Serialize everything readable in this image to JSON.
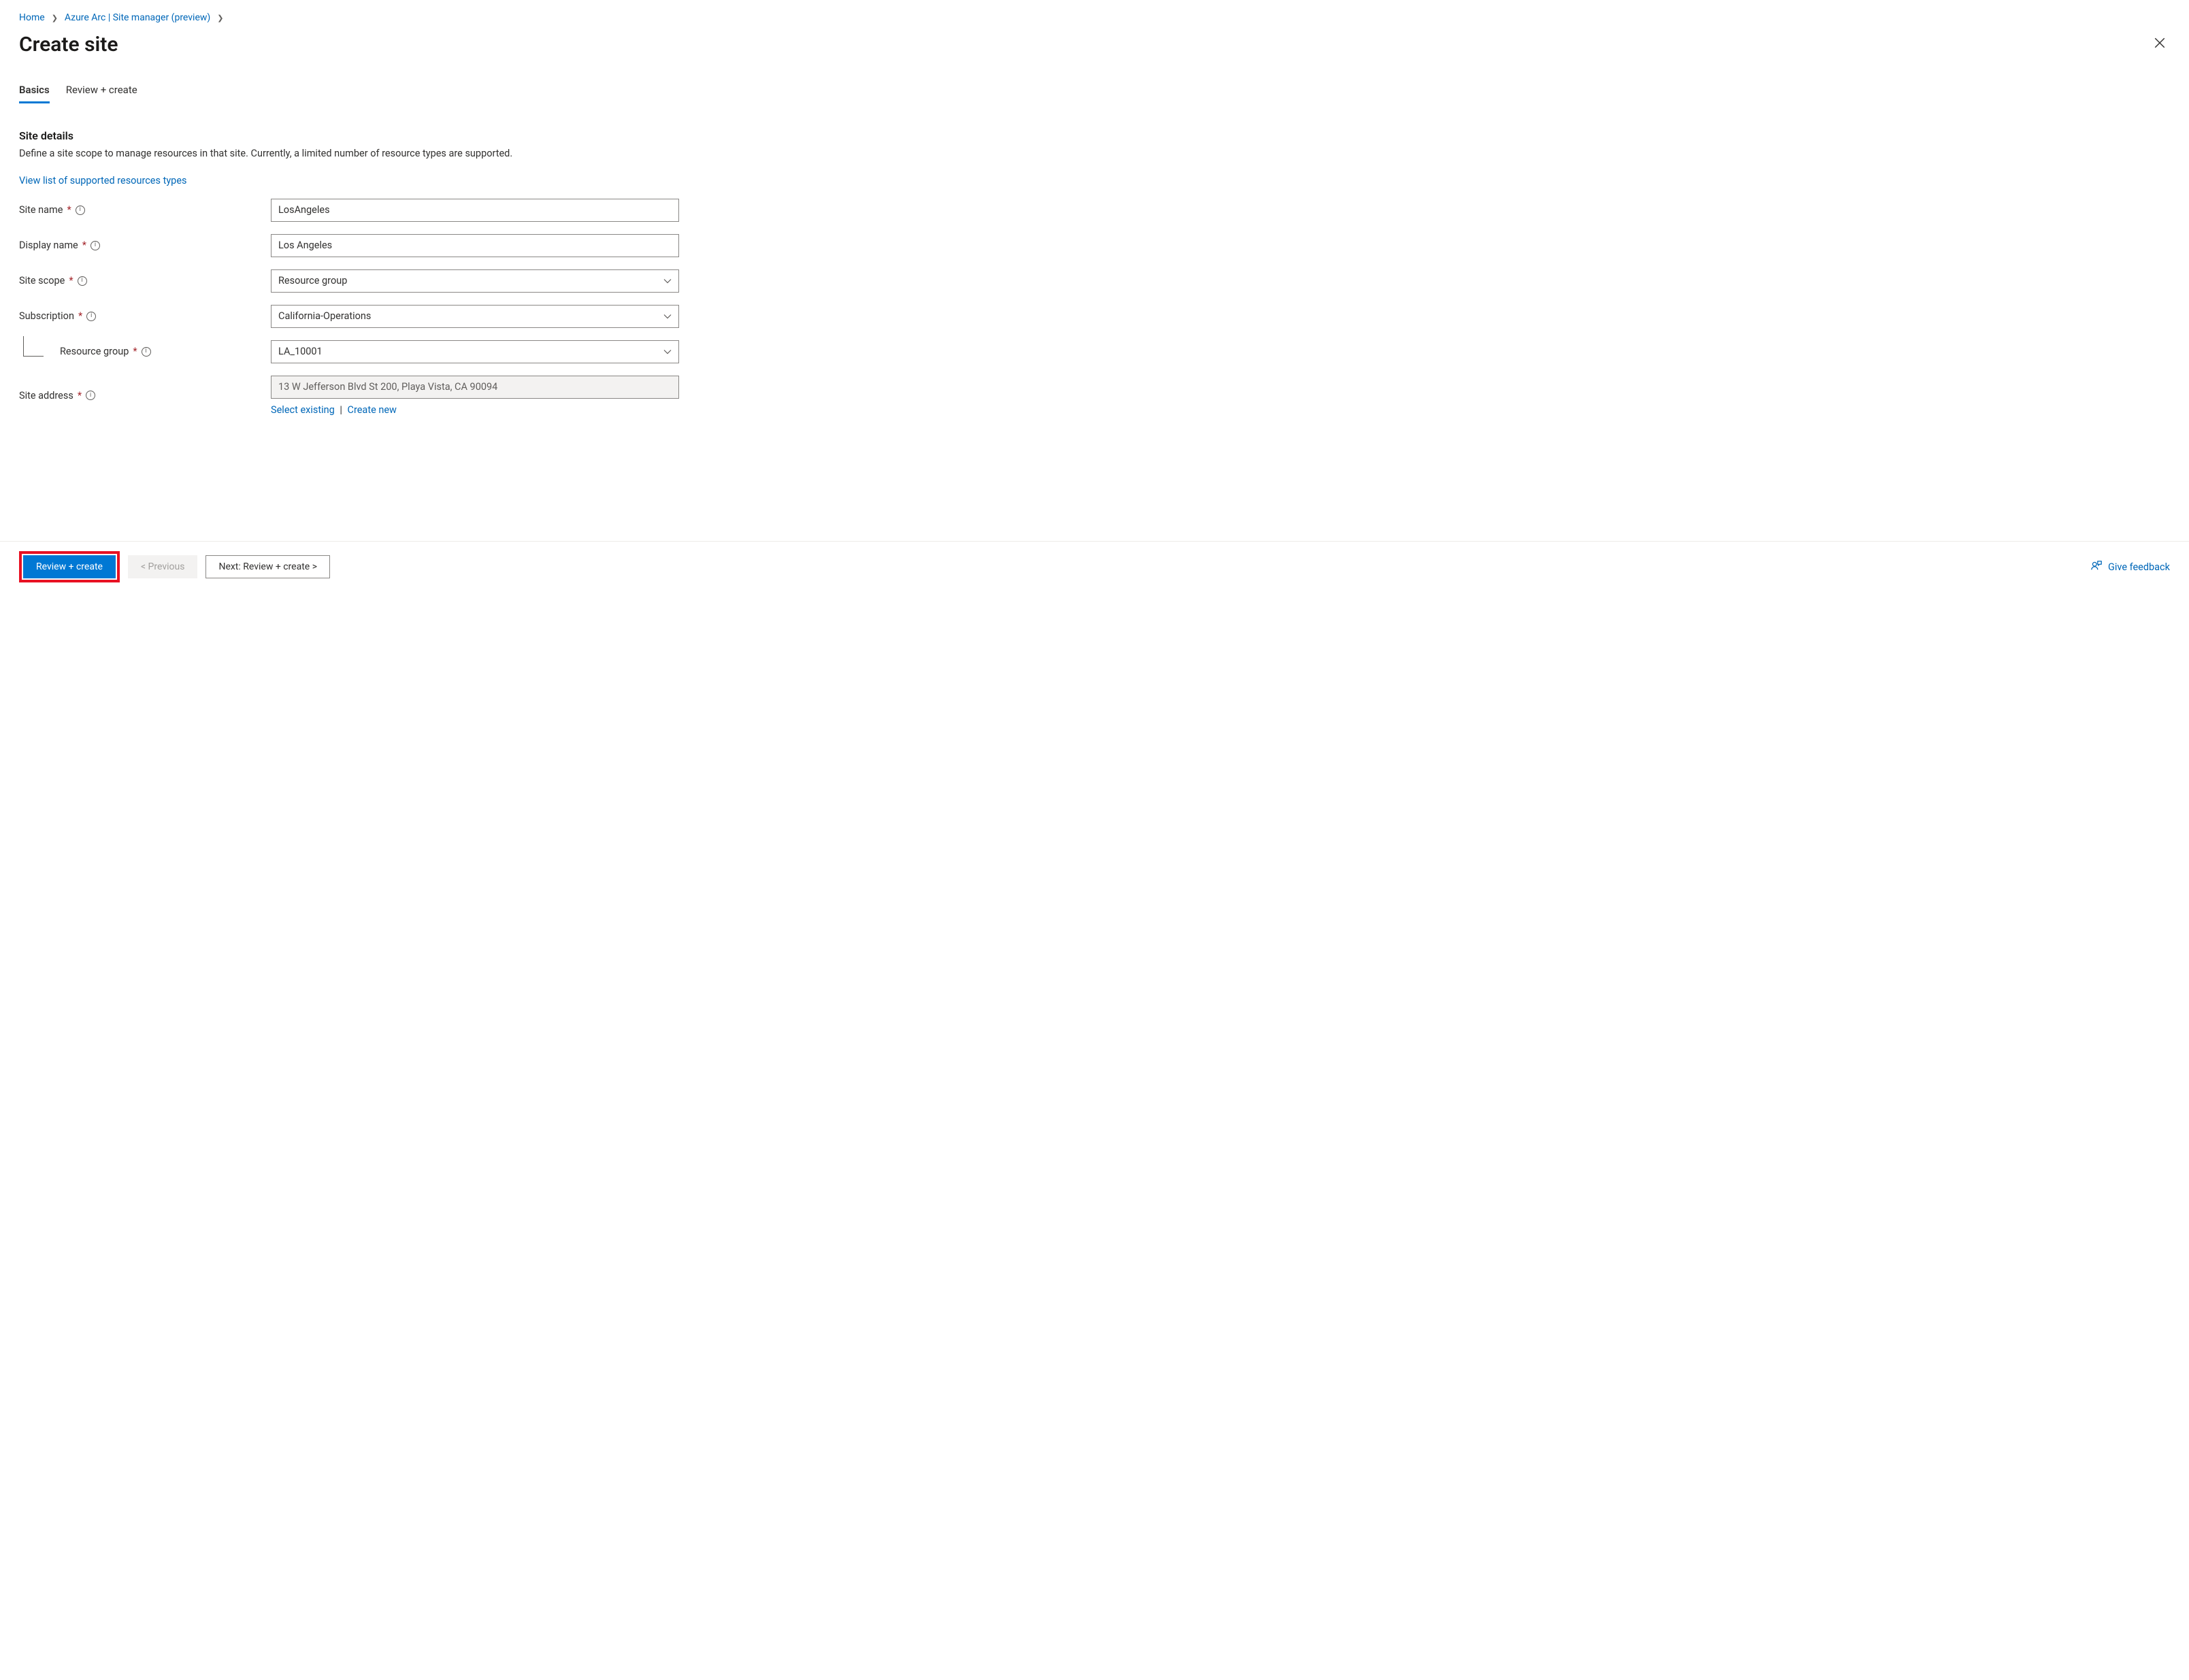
{
  "breadcrumb": {
    "home": "Home",
    "arc": "Azure Arc | Site manager (preview)"
  },
  "page_title": "Create site",
  "tabs": {
    "basics": "Basics",
    "review": "Review + create"
  },
  "section": {
    "title": "Site details",
    "desc": "Define a site scope to manage resources in that site. Currently, a limited number of resource types are supported.",
    "link": "View list of supported resources types"
  },
  "fields": {
    "site_name": {
      "label": "Site name",
      "value": "LosAngeles"
    },
    "display_name": {
      "label": "Display name",
      "value": "Los Angeles"
    },
    "site_scope": {
      "label": "Site scope",
      "value": "Resource group"
    },
    "subscription": {
      "label": "Subscription",
      "value": "California-Operations"
    },
    "resource_group": {
      "label": "Resource group",
      "value": "LA_10001"
    },
    "site_address": {
      "label": "Site address",
      "value": "13 W Jefferson Blvd St 200, Playa Vista, CA 90094"
    }
  },
  "address_links": {
    "select_existing": "Select existing",
    "create_new": "Create new"
  },
  "footer": {
    "review_create": "Review + create",
    "previous": "< Previous",
    "next": "Next: Review + create >",
    "feedback": "Give feedback"
  }
}
